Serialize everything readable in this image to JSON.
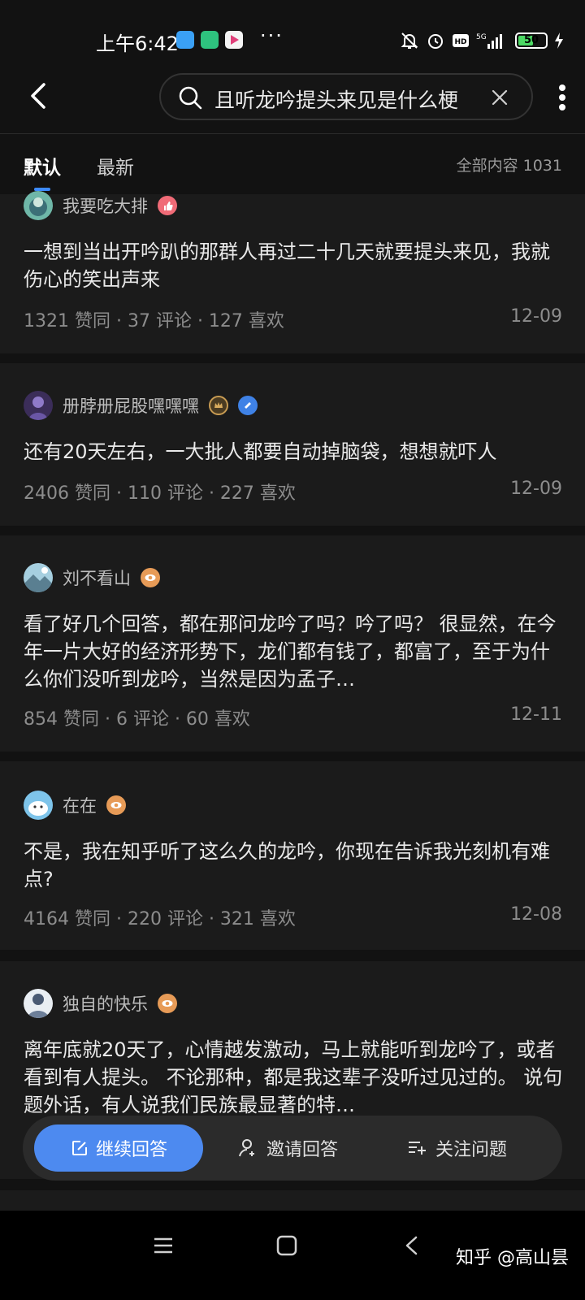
{
  "status_bar": {
    "time": "上午6:42",
    "battery": "50"
  },
  "header": {
    "search_query": "且听龙吟提头来见是什么梗"
  },
  "tabs": [
    {
      "label": "默认"
    },
    {
      "label": "最新"
    }
  ],
  "content_count": "全部内容 1031",
  "answers": [
    {
      "author": "我要吃大排",
      "excerpt": "一想到当出开吟趴的那群人再过二十几天就要提头来见，我就伤心的笑出声来",
      "meta": "1321  赞同 · 37  评论 · 127  喜欢",
      "date": "12-09"
    },
    {
      "author": "册脖册屁股嘿嘿嘿",
      "excerpt": "还有20天左右，一大批人都要自动掉脑袋，想想就吓人",
      "meta": "2406  赞同 · 110  评论 · 227  喜欢",
      "date": "12-09"
    },
    {
      "author": "刘不看山",
      "excerpt": "看了好几个回答，都在那问龙吟了吗？吟了吗？ 很显然，在今年一片大好的经济形势下，龙们都有钱了，都富了，至于为什么你们没听到龙吟，当然是因为孟子…",
      "meta": "854  赞同 · 6  评论 · 60  喜欢",
      "date": "12-11"
    },
    {
      "author": "在在",
      "excerpt": "不是，我在知乎听了这么久的龙吟，你现在告诉我光刻机有难点?",
      "meta": "4164  赞同 · 220  评论 · 321  喜欢",
      "date": "12-08"
    },
    {
      "author": "独自的快乐",
      "excerpt": "离年底就20天了，心情越发激动，马上就能听到龙吟了，或者看到有人提头。 不论那种，都是我这辈子没听过见过的。 说句题外话，有人说我们民族最显著的特…"
    }
  ],
  "action_bar": {
    "continue_answer": "继续回答",
    "invite_answer": "邀请回答",
    "follow_question": "关注问题"
  },
  "watermark": "知乎 @高山昙",
  "colors": {
    "background": "#121212",
    "card": "#1b1b1b",
    "accent": "#4d8af0"
  }
}
